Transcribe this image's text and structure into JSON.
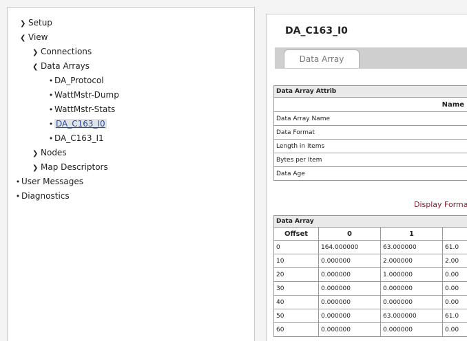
{
  "tree": {
    "items": [
      {
        "label": "Setup",
        "marker": "chevron-right"
      },
      {
        "label": "View",
        "marker": "chevron-down"
      },
      {
        "label": "Connections",
        "marker": "chevron-right"
      },
      {
        "label": "Data Arrays",
        "marker": "chevron-down"
      },
      {
        "label": "DA_Protocol",
        "marker": "bullet"
      },
      {
        "label": "WattMstr-Dump",
        "marker": "bullet"
      },
      {
        "label": "WattMstr-Stats",
        "marker": "bullet"
      },
      {
        "label": "DA_C163_I0",
        "marker": "bullet",
        "selected": true
      },
      {
        "label": "DA_C163_I1",
        "marker": "bullet"
      },
      {
        "label": "Nodes",
        "marker": "chevron-right"
      },
      {
        "label": "Map Descriptors",
        "marker": "chevron-right"
      },
      {
        "label": "User Messages",
        "marker": "bullet"
      },
      {
        "label": "Diagnostics",
        "marker": "bullet"
      }
    ]
  },
  "main": {
    "title": "DA_C163_I0",
    "tab_label": "Data Array",
    "attrib": {
      "header": "Data Array Attrib",
      "name_header": "Name",
      "rows": [
        "Data Array Name",
        "Data Format",
        "Length in Items",
        "Bytes per Item",
        "Data Age"
      ]
    },
    "display_format_label": "Display Format",
    "data_table": {
      "header": "Data Array",
      "columns": [
        "Offset",
        "0",
        "1",
        ""
      ],
      "rows": [
        [
          "0",
          "164.000000",
          "63.000000",
          "61.0"
        ],
        [
          "10",
          "0.000000",
          "2.000000",
          "2.00"
        ],
        [
          "20",
          "0.000000",
          "1.000000",
          "0.00"
        ],
        [
          "30",
          "0.000000",
          "0.000000",
          "0.00"
        ],
        [
          "40",
          "0.000000",
          "0.000000",
          "0.00"
        ],
        [
          "50",
          "0.000000",
          "63.000000",
          "61.0"
        ],
        [
          "60",
          "0.000000",
          "0.000000",
          "0.00"
        ]
      ]
    }
  },
  "colors": {
    "accent_text": "#8b1a2b",
    "selected_bg": "#dfe3ea",
    "tab_bar": "#cfcfcf"
  }
}
